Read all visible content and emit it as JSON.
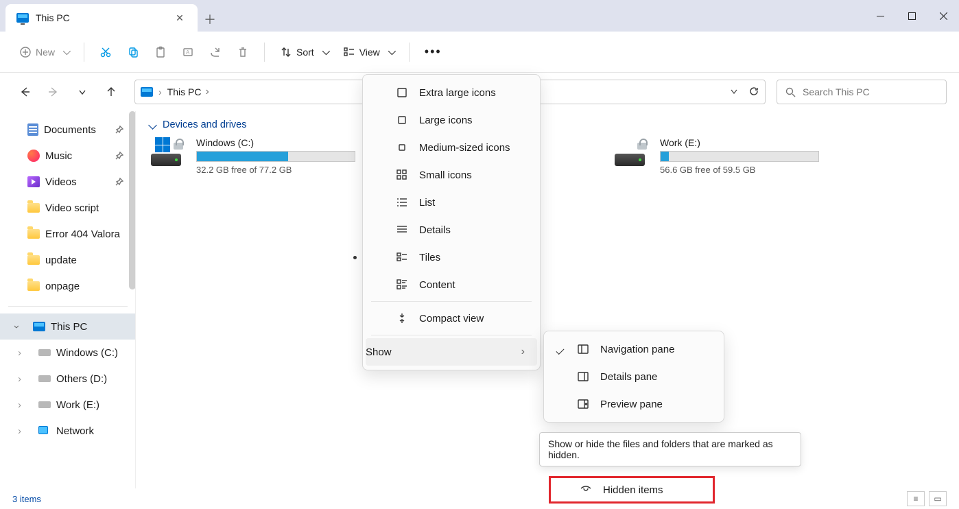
{
  "window": {
    "title": "This PC"
  },
  "toolbar": {
    "new": "New",
    "sort": "Sort",
    "view": "View"
  },
  "breadcrumb": {
    "root": "This PC",
    "chevron_ml": "➔"
  },
  "search": {
    "placeholder": "Search This PC"
  },
  "sidebar": {
    "quick": [
      {
        "label": "Documents",
        "pinned": true,
        "kind": "doc"
      },
      {
        "label": "Music",
        "pinned": true,
        "kind": "music"
      },
      {
        "label": "Videos",
        "pinned": true,
        "kind": "video"
      },
      {
        "label": "Video script",
        "pinned": false,
        "kind": "folder"
      },
      {
        "label": "Error 404 Valora",
        "pinned": false,
        "kind": "folder"
      },
      {
        "label": "update",
        "pinned": false,
        "kind": "folder"
      },
      {
        "label": "onpage",
        "pinned": false,
        "kind": "folder"
      }
    ],
    "thispc": {
      "label": "This PC"
    },
    "drives": [
      {
        "label": "Windows (C:)"
      },
      {
        "label": "Others (D:)"
      },
      {
        "label": "Work (E:)"
      }
    ],
    "network": {
      "label": "Network"
    }
  },
  "content": {
    "group": "Devices and drives",
    "drives": [
      {
        "name": "Windows (C:)",
        "free_text": "32.2 GB free of 77.2 GB",
        "fill_pct": 58,
        "show_winlogo": true
      },
      {
        "name": "Work (E:)",
        "free_text": "56.6 GB free of 59.5 GB",
        "fill_pct": 5,
        "show_winlogo": false
      }
    ]
  },
  "view_menu": {
    "items": [
      {
        "label": "Extra large icons"
      },
      {
        "label": "Large icons"
      },
      {
        "label": "Medium-sized icons"
      },
      {
        "label": "Small icons"
      },
      {
        "label": "List"
      },
      {
        "label": "Details"
      },
      {
        "label": "Tiles",
        "selected": true
      },
      {
        "label": "Content"
      }
    ],
    "compact": "Compact view",
    "show": "Show"
  },
  "show_menu": {
    "items": [
      {
        "label": "Navigation pane",
        "checked": true
      },
      {
        "label": "Details pane",
        "checked": false
      },
      {
        "label": "Preview pane",
        "checked": false
      }
    ],
    "hidden": "Hidden items"
  },
  "tooltip": {
    "text": "Show or hide the files and folders that are marked as hidden."
  },
  "status": {
    "items": "3 items"
  }
}
